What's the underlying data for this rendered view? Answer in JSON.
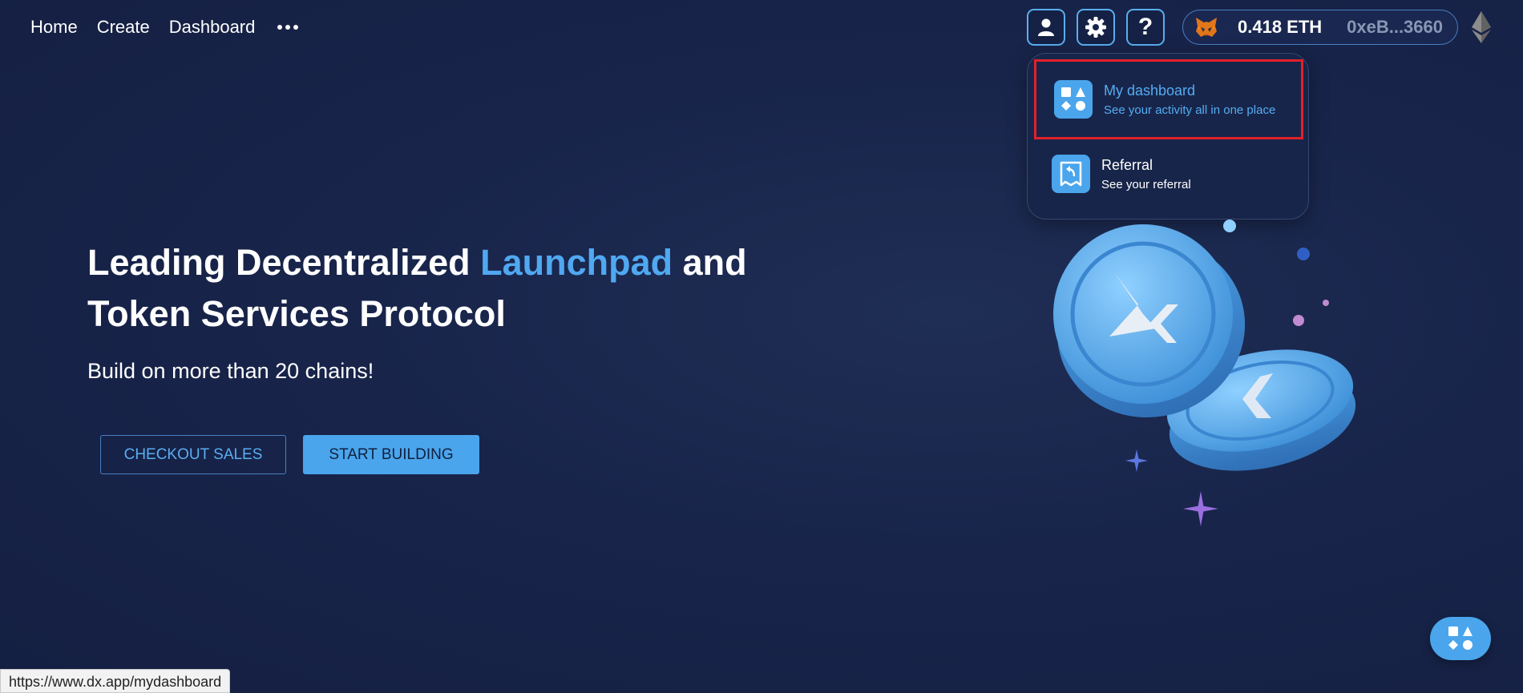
{
  "nav": {
    "links": [
      "Home",
      "Create",
      "Dashboard"
    ],
    "more_icon": "more-horizontal-icon",
    "user_icon": "user-icon",
    "settings_icon": "gear-icon",
    "help_label": "?"
  },
  "wallet": {
    "wallet_icon": "metamask-fox-icon",
    "balance": "0.418 ETH",
    "address": "0xeB...3660",
    "network_icon": "ethereum-icon"
  },
  "dropdown": {
    "items": [
      {
        "title": "My dashboard",
        "subtitle": "See your activity all in one place",
        "icon": "shapes-icon",
        "highlighted": true
      },
      {
        "title": "Referral",
        "subtitle": "See your referral",
        "icon": "referral-icon",
        "highlighted": false
      }
    ]
  },
  "hero": {
    "title_part1": "Leading Decentralized ",
    "title_accent": "Launchpad",
    "title_part2": " and",
    "title_line2": "Token Services Protocol",
    "subtitle": "Build on more than 20 chains!",
    "checkout_label": "CHECKOUT SALES",
    "start_label": "START BUILDING"
  },
  "fab": {
    "icon": "shapes-icon"
  },
  "status_bar": {
    "url": "https://www.dx.app/mydashboard"
  },
  "colors": {
    "background": "#18244a",
    "accent": "#4aa5ec",
    "highlight_border": "#e2202a",
    "address_text": "#8a96b4"
  }
}
